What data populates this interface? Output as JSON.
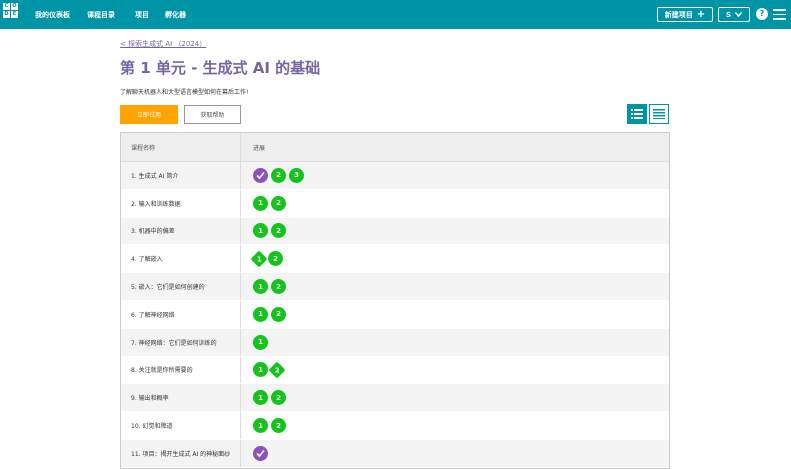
{
  "logo": {
    "letters": [
      "C",
      "O",
      "D",
      "E"
    ]
  },
  "nav": {
    "dashboard": "我的仪表板",
    "catalog": "课程目录",
    "projects": "项目",
    "incubator": "孵化器",
    "new_project": "新建项目",
    "user": "S",
    "help": "?"
  },
  "breadcrumb": "< 探索生成式 AI （2024）",
  "title": "第 1 单元 - 生成式 AI 的基础",
  "description": "了解聊天机器人和大型语言模型如何在幕后工作!",
  "buttons": {
    "try_now": "立即试用",
    "get_help": "获取帮助"
  },
  "table": {
    "col_name": "课程名称",
    "col_progress": "进展",
    "rows": [
      {
        "name": "1. 生成式 AI 简介",
        "bubbles": [
          {
            "type": "purple-check",
            "label": ""
          },
          {
            "type": "circle",
            "label": "2"
          },
          {
            "type": "circle",
            "label": "3"
          }
        ]
      },
      {
        "name": "2. 输入和训练数据",
        "bubbles": [
          {
            "type": "circle",
            "label": "1"
          },
          {
            "type": "circle",
            "label": "2"
          }
        ]
      },
      {
        "name": "3. 机器中的偏差",
        "bubbles": [
          {
            "type": "circle",
            "label": "1"
          },
          {
            "type": "circle",
            "label": "2"
          }
        ]
      },
      {
        "name": "4. 了解嵌入",
        "bubbles": [
          {
            "type": "diamond",
            "label": "1"
          },
          {
            "type": "circle",
            "label": "2"
          }
        ]
      },
      {
        "name": "5. 嵌入：它们是如何创建的",
        "bubbles": [
          {
            "type": "circle",
            "label": "1"
          },
          {
            "type": "circle",
            "label": "2"
          }
        ]
      },
      {
        "name": "6. 了解神经网络",
        "bubbles": [
          {
            "type": "circle",
            "label": "1"
          },
          {
            "type": "circle",
            "label": "2"
          }
        ]
      },
      {
        "name": "7. 神经网络：它们是如何训练的",
        "bubbles": [
          {
            "type": "circle",
            "label": "1"
          }
        ]
      },
      {
        "name": "8. 关注就是你所需要的",
        "bubbles": [
          {
            "type": "circle",
            "label": "1"
          },
          {
            "type": "diamond",
            "label": "2"
          }
        ]
      },
      {
        "name": "9. 输出和概率",
        "bubbles": [
          {
            "type": "circle",
            "label": "1"
          },
          {
            "type": "circle",
            "label": "2"
          }
        ]
      },
      {
        "name": "10. 幻觉和障道",
        "bubbles": [
          {
            "type": "circle",
            "label": "1"
          },
          {
            "type": "circle",
            "label": "2"
          }
        ]
      },
      {
        "name": "11. 项目：揭开生成式 AI 的神秘面纱",
        "bubbles": [
          {
            "type": "purple-check",
            "label": ""
          }
        ]
      }
    ]
  }
}
